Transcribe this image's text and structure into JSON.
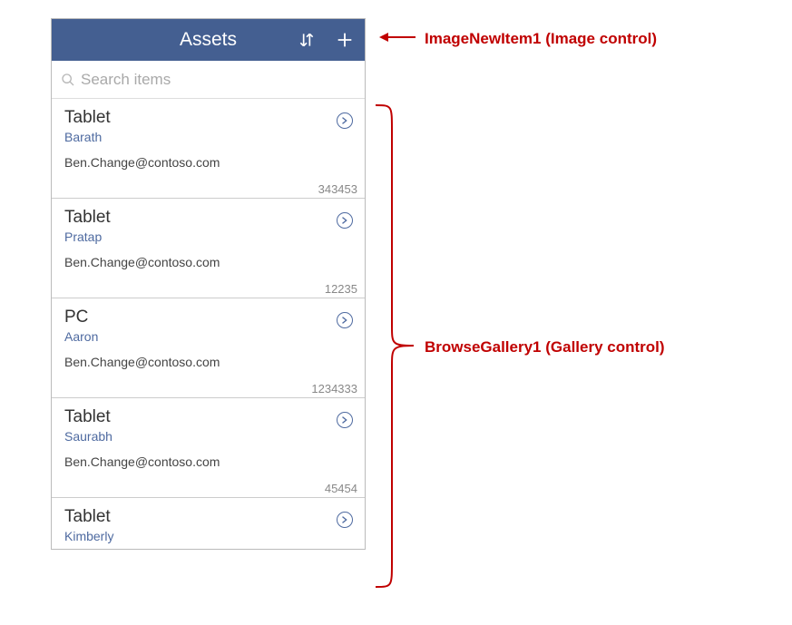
{
  "header": {
    "title": "Assets"
  },
  "search": {
    "placeholder": "Search items"
  },
  "gallery": {
    "items": [
      {
        "title": "Tablet",
        "sub": "Barath",
        "email": "Ben.Change@contoso.com",
        "number": "343453"
      },
      {
        "title": "Tablet",
        "sub": "Pratap",
        "email": "Ben.Change@contoso.com",
        "number": "12235"
      },
      {
        "title": "PC",
        "sub": "Aaron",
        "email": "Ben.Change@contoso.com",
        "number": "1234333"
      },
      {
        "title": "Tablet",
        "sub": "Saurabh",
        "email": "Ben.Change@contoso.com",
        "number": "45454"
      },
      {
        "title": "Tablet",
        "sub": "Kimberly",
        "email": "",
        "number": ""
      }
    ]
  },
  "annotations": {
    "newitem": "ImageNewItem1 (Image control)",
    "gallery": "BrowseGallery1 (Gallery control)"
  }
}
